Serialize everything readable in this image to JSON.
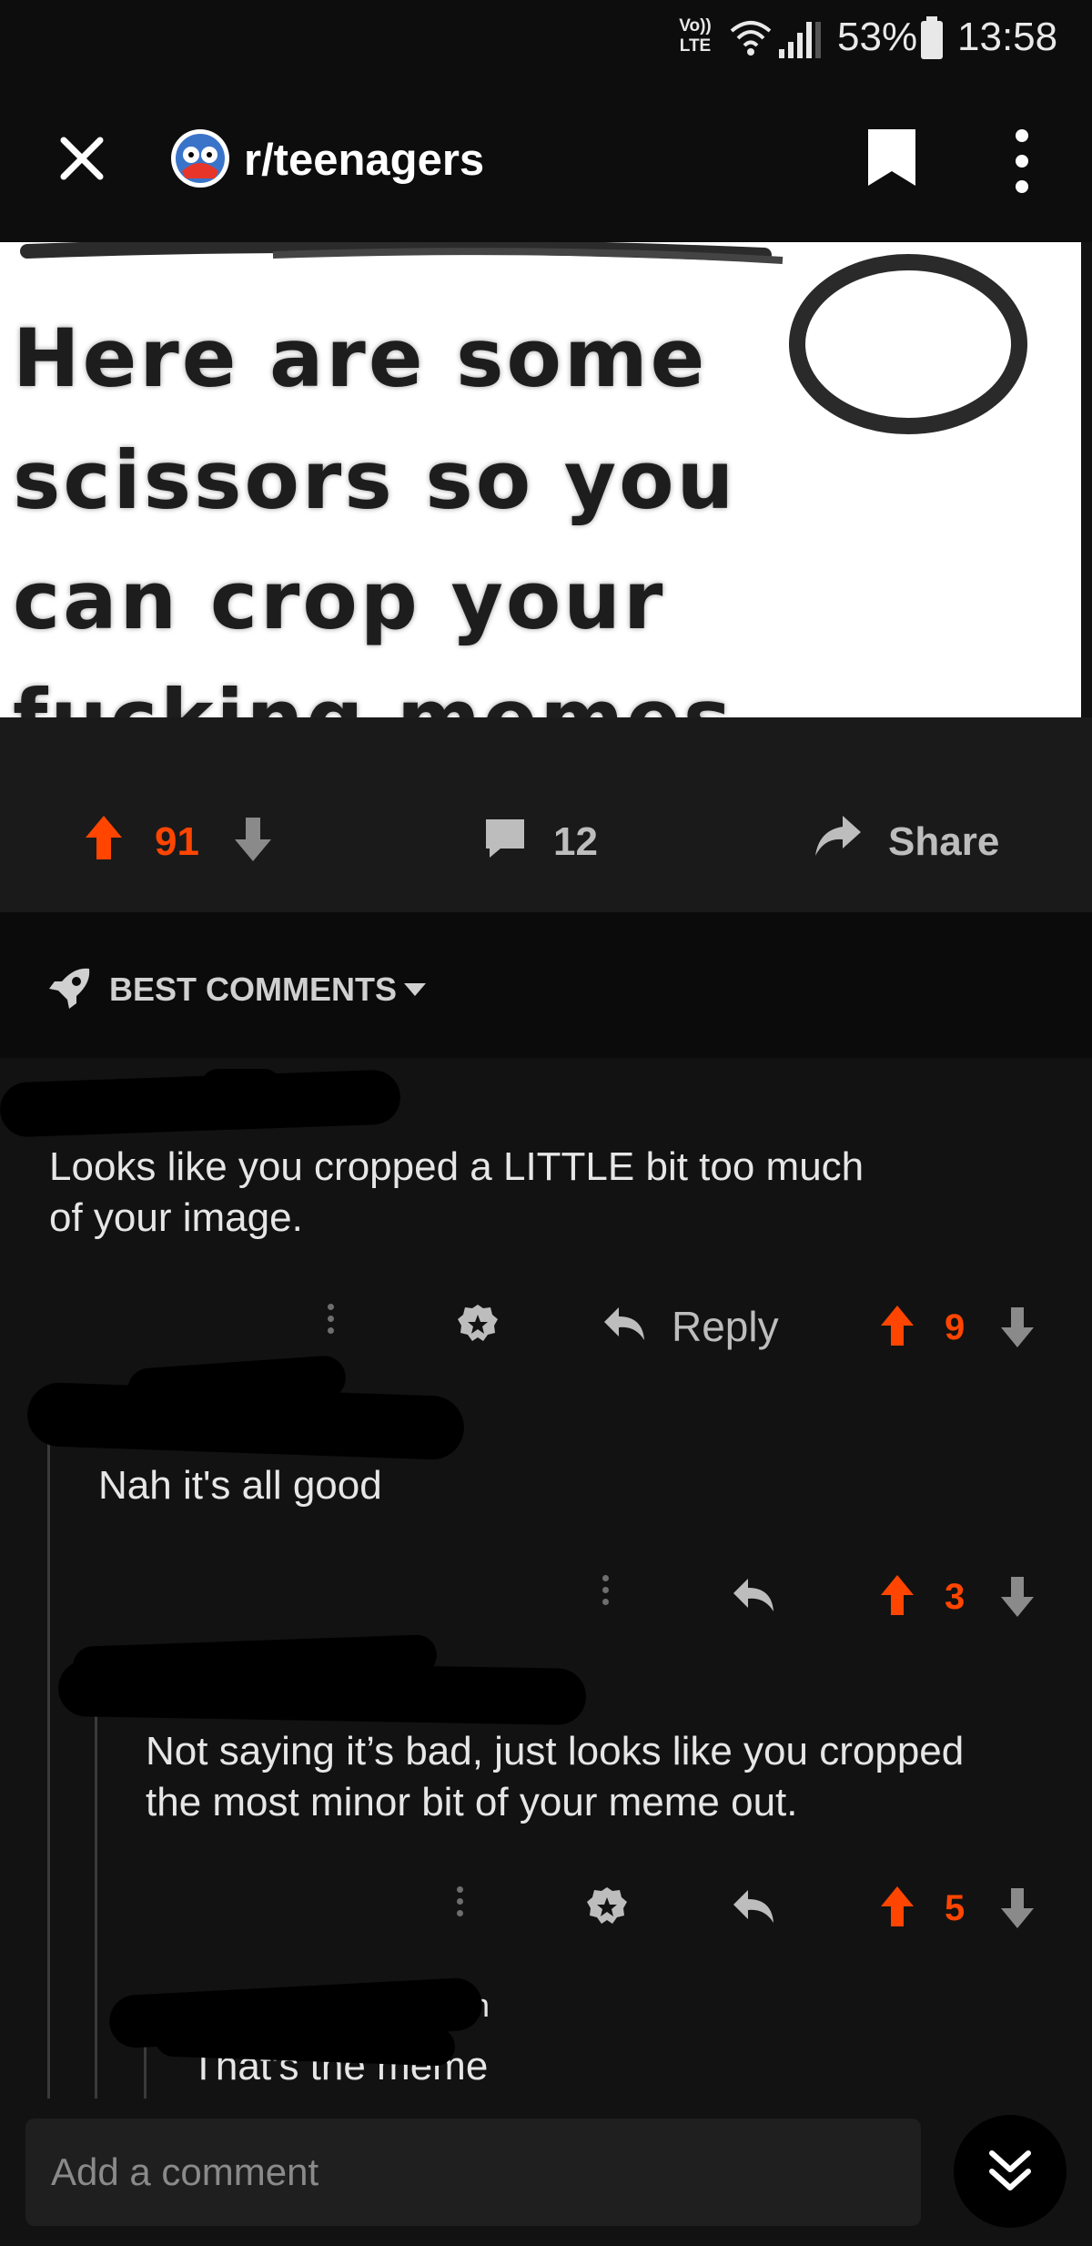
{
  "status_bar": {
    "network": "Vo)) LTE",
    "battery": "53%",
    "time": "13:58"
  },
  "header": {
    "subreddit": "r/teenagers",
    "icons": [
      "close-icon",
      "subreddit-avatar",
      "bookmark-icon",
      "more-vertical-icon"
    ]
  },
  "post": {
    "image_text": [
      "Here are some",
      "scissors so you",
      "can crop your",
      "fucking memes"
    ],
    "upvotes": "91",
    "comments": "12",
    "share_label": "Share"
  },
  "sort": {
    "label": "BEST COMMENTS"
  },
  "comments": [
    {
      "text_lines": [
        "Looks like you cropped a LITTLE bit too much",
        "of your image."
      ],
      "reply_label": "Reply",
      "score": "9"
    },
    {
      "text_lines": [
        "Nah it's all good"
      ],
      "score": "3"
    },
    {
      "text_lines": [
        "Not saying it’s bad, just looks like you cropped",
        "the most minor bit of your meme out."
      ],
      "score": "5"
    },
    {
      "author_fragment": "h",
      "text_lines": [
        "That's the meme"
      ]
    }
  ],
  "composer": {
    "placeholder": "Add a comment"
  },
  "colors": {
    "upvote": "#ff4500",
    "background": "#121212",
    "text": "#e6e6e6"
  }
}
